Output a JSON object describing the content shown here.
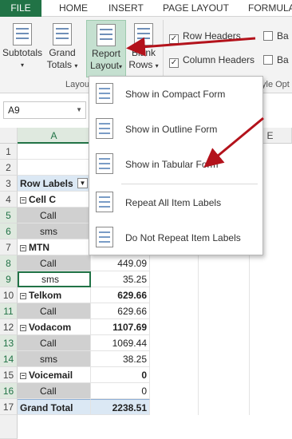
{
  "ribbon_tabs": [
    "FILE",
    "HOME",
    "INSERT",
    "PAGE LAYOUT",
    "FORMULA"
  ],
  "ribbon": {
    "subtotals": "Subtotals",
    "grand_totals_1": "Grand",
    "grand_totals_2": "Totals",
    "report_layout_1": "Report",
    "report_layout_2": "Layout",
    "blank_rows_1": "Blank",
    "blank_rows_2": "Rows",
    "group_layout": "Layou",
    "group_style_options": "yle Opt",
    "row_headers": "Row Headers",
    "column_headers": "Column Headers",
    "banded_1": "Ba",
    "banded_2": "Ba",
    "row_headers_checked": true,
    "column_headers_checked": true
  },
  "name_box": "A9",
  "column_headers": {
    "A": "A",
    "E": "E"
  },
  "rows": [
    {
      "num": "1",
      "a": "",
      "b": ""
    },
    {
      "num": "2",
      "a": "",
      "b": ""
    },
    {
      "num": "3",
      "a": "Row Labels",
      "b": ""
    },
    {
      "num": "4",
      "a": "Cell C",
      "b": ""
    },
    {
      "num": "5",
      "a": "Call",
      "b": ""
    },
    {
      "num": "6",
      "a": "sms",
      "b": ""
    },
    {
      "num": "7",
      "a": "MTN",
      "b": ""
    },
    {
      "num": "8",
      "a": "Call",
      "b": "449.09"
    },
    {
      "num": "9",
      "a": "sms",
      "b": "35.25"
    },
    {
      "num": "10",
      "a": "Telkom",
      "b": "629.66"
    },
    {
      "num": "11",
      "a": "Call",
      "b": "629.66"
    },
    {
      "num": "12",
      "a": "Vodacom",
      "b": "1107.69"
    },
    {
      "num": "13",
      "a": "Call",
      "b": "1069.44"
    },
    {
      "num": "14",
      "a": "sms",
      "b": "38.25"
    },
    {
      "num": "15",
      "a": "Voicemail",
      "b": "0"
    },
    {
      "num": "16",
      "a": "Call",
      "b": "0"
    },
    {
      "num": "17",
      "a": "Grand Total",
      "b": "2238.51"
    }
  ],
  "menu": {
    "compact": "Show in Compact Form",
    "outline": "Show in Outline Form",
    "tabular": "Show in Tabular Form",
    "repeat": "Repeat All Item Labels",
    "no_repeat": "Do Not Repeat Item Labels"
  },
  "colors": {
    "excel_green": "#217346",
    "arrow_red": "#b3121b",
    "active_button": "#c5e0d0",
    "selected_row_fill": "#d0d0d0",
    "grand_total_fill": "#dbe8f4"
  }
}
